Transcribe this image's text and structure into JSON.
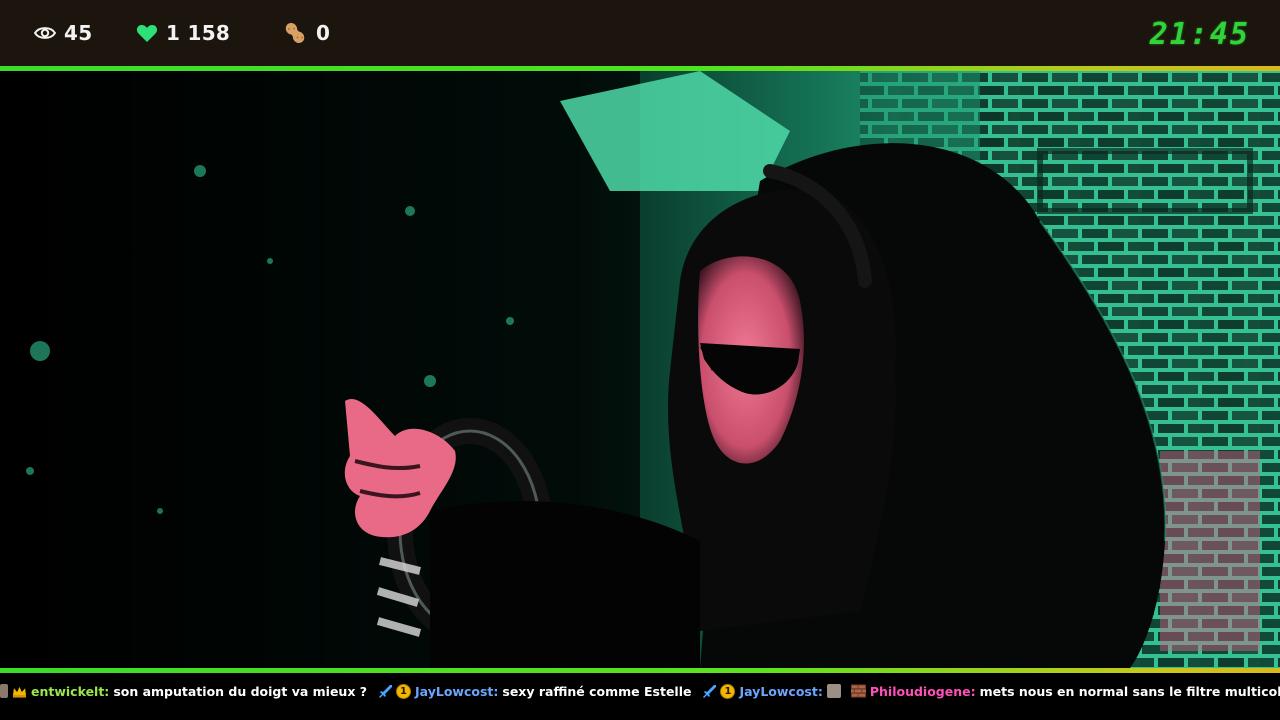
{
  "stats": {
    "viewers": "45",
    "hearts": "1 158",
    "peanuts": "0"
  },
  "clock": "21:45",
  "colors": {
    "accent_green": "#2fd43a",
    "heart_green": "#2ee07a",
    "top_bar_bg": "#1c150d",
    "video_tint": "#2fb890",
    "skin_tint": "#e86a86"
  },
  "icons": {
    "viewers": "eye-icon",
    "hearts": "heart-icon",
    "peanuts": "peanut-icon"
  },
  "chat": [
    {
      "user": "entwickelt:",
      "user_color": "#9ae74a",
      "text": "son amputation du doigt va mieux ?",
      "badges": [
        "avatar",
        "crown"
      ]
    },
    {
      "user": "JayLowcost:",
      "user_color": "#6aa6ff",
      "text": "sexy raffiné comme Estelle",
      "badges": [
        "sword",
        "coin"
      ],
      "coin_label": "1"
    },
    {
      "user": "JayLowcost:",
      "user_color": "#6aa6ff",
      "text": "",
      "badges": [
        "sword",
        "coin",
        "avatar"
      ],
      "coin_label": "1"
    },
    {
      "user": "Philoudiogene:",
      "user_color": "#ff4fb8",
      "text": "mets nous en normal sans le filtre multicolor stp",
      "badges": [
        "brick"
      ]
    }
  ]
}
